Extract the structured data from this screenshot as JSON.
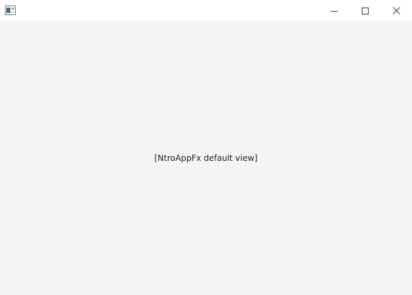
{
  "window": {
    "icon": "javafx-app-icon",
    "controls": {
      "minimize_icon": "minimize-icon",
      "maximize_icon": "maximize-icon",
      "close_icon": "close-icon"
    }
  },
  "content": {
    "label": "[NtroAppFx default view]"
  },
  "colors": {
    "titlebar_bg": "#ffffff",
    "content_bg": "#f4f4f4",
    "text": "#222222",
    "icon_stroke": "#333333"
  }
}
